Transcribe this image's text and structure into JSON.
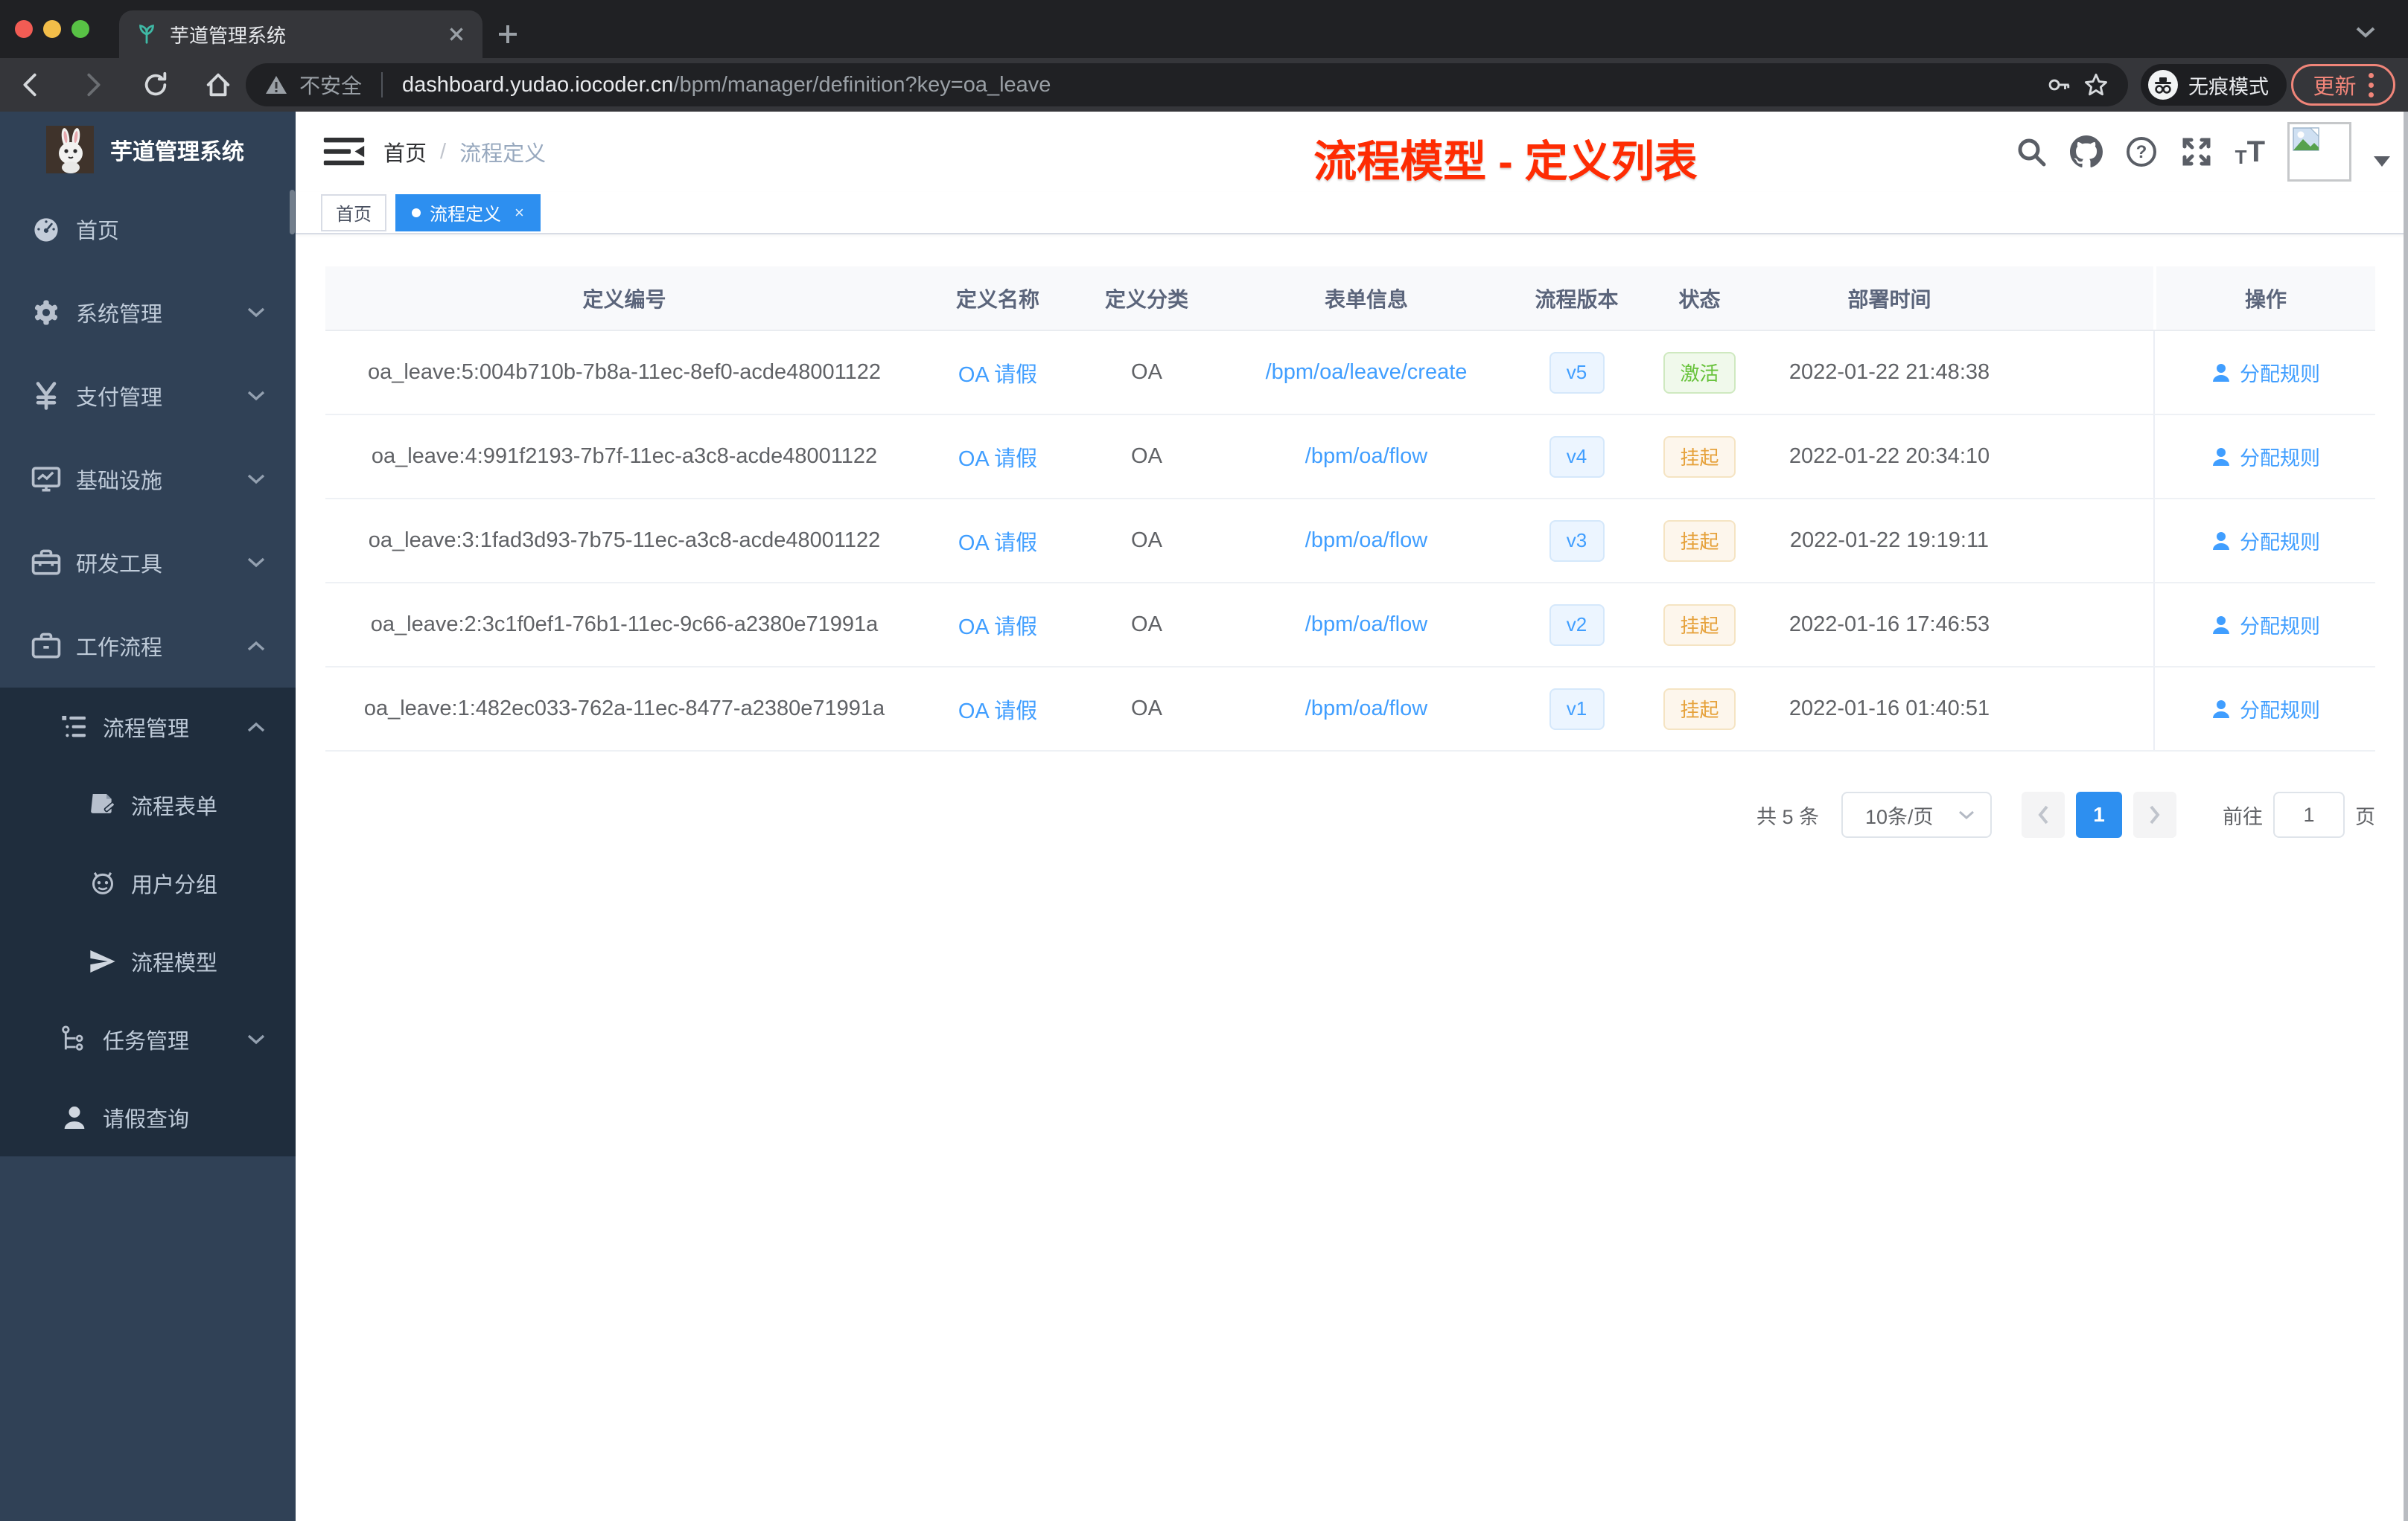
{
  "chrome": {
    "tab_title": "芋道管理系统",
    "security_label": "不安全",
    "url_host": "dashboard.yudao.iocoder.cn",
    "url_path": "/bpm/manager/definition?key=oa_leave",
    "incognito_label": "无痕模式",
    "update_label": "更新"
  },
  "sidebar": {
    "app_title": "芋道管理系统",
    "menu": [
      {
        "label": "首页"
      },
      {
        "label": "系统管理"
      },
      {
        "label": "支付管理"
      },
      {
        "label": "基础设施"
      },
      {
        "label": "研发工具"
      },
      {
        "label": "工作流程"
      }
    ],
    "submenu": [
      {
        "label": "流程管理"
      },
      {
        "label": "流程表单"
      },
      {
        "label": "用户分组"
      },
      {
        "label": "流程模型"
      },
      {
        "label": "任务管理"
      },
      {
        "label": "请假查询"
      }
    ]
  },
  "navbar": {
    "breadcrumb_home": "首页",
    "breadcrumb_sep": "/",
    "breadcrumb_current": "流程定义",
    "annotation": "流程模型 - 定义列表"
  },
  "tags": {
    "home": "首页",
    "active": "流程定义",
    "close": "×"
  },
  "table": {
    "columns": [
      "定义编号",
      "定义名称",
      "定义分类",
      "表单信息",
      "流程版本",
      "状态",
      "部署时间",
      "操作"
    ],
    "action_label": "分配规则",
    "rows": [
      {
        "id": "oa_leave:5:004b710b-7b8a-11ec-8ef0-acde48001122",
        "name": "OA 请假",
        "category": "OA",
        "form": "/bpm/oa/leave/create",
        "version": "v5",
        "status": "激活",
        "time": "2022-01-22 21:48:38"
      },
      {
        "id": "oa_leave:4:991f2193-7b7f-11ec-a3c8-acde48001122",
        "name": "OA 请假",
        "category": "OA",
        "form": "/bpm/oa/flow",
        "version": "v4",
        "status": "挂起",
        "time": "2022-01-22 20:34:10"
      },
      {
        "id": "oa_leave:3:1fad3d93-7b75-11ec-a3c8-acde48001122",
        "name": "OA 请假",
        "category": "OA",
        "form": "/bpm/oa/flow",
        "version": "v3",
        "status": "挂起",
        "time": "2022-01-22 19:19:11"
      },
      {
        "id": "oa_leave:2:3c1f0ef1-76b1-11ec-9c66-a2380e71991a",
        "name": "OA 请假",
        "category": "OA",
        "form": "/bpm/oa/flow",
        "version": "v2",
        "status": "挂起",
        "time": "2022-01-16 17:46:53"
      },
      {
        "id": "oa_leave:1:482ec033-762a-11ec-8477-a2380e71991a",
        "name": "OA 请假",
        "category": "OA",
        "form": "/bpm/oa/flow",
        "version": "v1",
        "status": "挂起",
        "time": "2022-01-16 01:40:51"
      }
    ]
  },
  "pagination": {
    "total": "共 5 条",
    "page_size": "10条/页",
    "page": "1",
    "goto_label": "前往",
    "goto_value": "1",
    "unit": "页"
  },
  "colors": {
    "accent": "#409eff",
    "status_active_green": "#67c23a",
    "status_suspended_orange": "#e6a23c",
    "annotation_red": "#fe2c03",
    "sidebar_bg": "#304156",
    "submenu_bg": "#1f2d3d"
  }
}
